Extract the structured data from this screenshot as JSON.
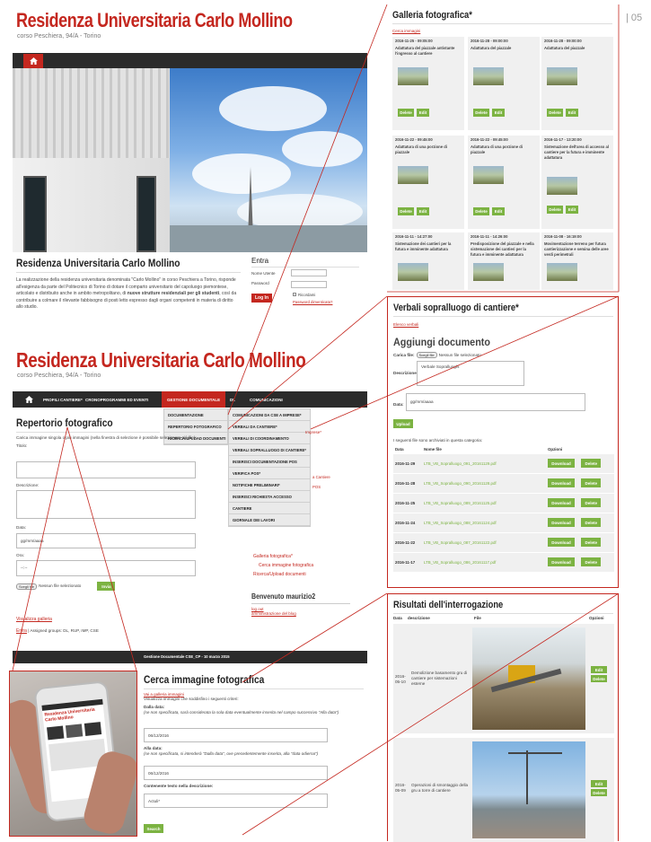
{
  "page_number": "| 05",
  "header1": {
    "title": "Residenza Universitaria Carlo Mollino",
    "subtitle": "corso Peschiera, 94/A - Torino"
  },
  "intro": {
    "title": "Residenza Universitaria Carlo Mollino",
    "text1": "La realizzazione della residenza universitaria denominata \"Carlo Mollino\" in corso Peschiera a Torino, risponde all'esigenza da parte del Politecnico di Torino di dotare il comparto universitario del capoluogo piemontese, articolato e distribuito anche in ambito metropolitano, di",
    "bold": "nuove strutture residenziali per gli studenti",
    "text2": ", così da contribuire a colmare il rilevante fabbisogno di posti letto espresso dagli organi competenti in materia di diritto allo studio."
  },
  "login": {
    "title": "Entra",
    "user_label": "Nome Utente",
    "pass_label": "Password",
    "button": "Log In",
    "remember": "Ricordami",
    "forgot": "Password dimenticata?"
  },
  "header2": {
    "title": "Residenza Universitaria Carlo Mollino",
    "subtitle": "corso Peschiera, 94/A - Torino"
  },
  "nav": {
    "items": [
      "PROFILI CANTIERE*",
      "CRONOPROGRAMMI ED EVENTI",
      "GESTIONE DOCUMENTALE",
      "DL",
      "COMUNICAZIONI"
    ]
  },
  "dropdown1": [
    "DOCUMENTAZIONE",
    "REPERTORIO FOTOGRAFICO",
    "RICERCA/UPLOAD DOCUMENTI"
  ],
  "dropdown2": [
    "COMUNICAZIONI DA CSE A IMPRESE*",
    "VERBALI DA CANTIERE*",
    "VERBALI DI COORDINAMENTO",
    "VERBALI SOPRALLUOGO DI CANTIERE*",
    "INSERISCI DOCUMENTAZIONE POS",
    "VERIFICA POS*",
    "NOTIFICHE PRELIMINARI*",
    "INSERISCI RICHIESTA ACCESSO",
    "CANTIERE",
    "GIORNALE DEI LAVORI"
  ],
  "repertorio": {
    "title": "Repertorio fotografico",
    "desc": "Carica immagine singola o più immagini (nella finestra di selezione è possibile selezionare più file):",
    "titolo": "Titolo:",
    "descrizione": "Descrizione:",
    "data": "Data:",
    "data_ph": "gg/mm/aaaa",
    "ora": "Ora:",
    "ora_ph": "--:--",
    "file_btn": "Scegli file",
    "no_file": "Nessun file selezionato",
    "invia": "Invia",
    "visualizza": "Visualizza galleria",
    "footer_link": "Entra",
    "footer_text": "| Assigned groups: DL, RUP, IMP, CSE"
  },
  "sidebar": {
    "links": [
      "Imprese*",
      "…",
      "a Cantiere",
      "POS"
    ],
    "sub_links": [
      "Galleria fotografica*",
      "Cerca immagine fotografica",
      "Ricerca/Upload documenti"
    ],
    "welcome": "Benvenuto maurizio2",
    "logout": "log out",
    "admin": "amministrazione del blog"
  },
  "footerbar": "Gestione Documentale CSE_CP - 10 marzo 2015",
  "galleria": {
    "title": "Galleria fotografica*",
    "link": "Cerca immagini",
    "items": [
      {
        "date": "2016-11-25 - 09:05:00",
        "desc": "Adattatura del piazzale antistante l'ingresso al cantiere"
      },
      {
        "date": "2016-11-28 - 09:00:00",
        "desc": "Adattatura del piazzale"
      },
      {
        "date": "2016-11-28 - 09:00:00",
        "desc": "Adattatura del piazzale"
      },
      {
        "date": "2016-11-22 - 09:45:00",
        "desc": "Adattatura di una porzione di piazzale"
      },
      {
        "date": "2016-11-22 - 09:45:00",
        "desc": "Adattatura di una porzione di piazzale"
      },
      {
        "date": "2016-11-17 - 13:20:00",
        "desc": "Sistemazione dell'area di accesso al cantiere per la futura e imminente adattatura"
      },
      {
        "date": "2016-11-11 - 14:27:00",
        "desc": "Sistemazione dei cantieri per la futura e imminente adattatura"
      },
      {
        "date": "2016-11-11 - 14:26:00",
        "desc": "Predisposizione del piazzale e nella sistemazione dei cantieri per la futura e imminente adattatura"
      },
      {
        "date": "2016-11-08 - 16:19:00",
        "desc": "Movimentazione terreno per futura cantierizzazione e semina delle aree verdi perimetrali"
      }
    ],
    "delete": "Delete",
    "edit": "Edit"
  },
  "verbali": {
    "title": "Verbali sopralluogo di cantiere*",
    "link": "Elenco verbali",
    "subtitle": "Aggiungi documento",
    "carica": "Carica file:",
    "file_btn": "Scegli file",
    "no_file": "Nessun file selezionato",
    "descr_label": "Descrizione:",
    "descr_val": "Verbale Sopralluoghi",
    "data_label": "Data:",
    "data_val": "gg/mm/aaaa",
    "upload": "Upload",
    "info": "I seguenti file sono archiviati in questa categoria:",
    "cols": [
      "Data",
      "Nome file",
      "Opzioni"
    ],
    "rows": [
      {
        "date": "2016-11-29",
        "file": "LTB_VB_Sopralluogo_091_20161129.pdf"
      },
      {
        "date": "2016-11-28",
        "file": "LTB_VB_Sopralluogo_090_20161128.pdf"
      },
      {
        "date": "2016-11-25",
        "file": "LTB_VB_Sopralluogo_089_20161125.pdf"
      },
      {
        "date": "2016-11-24",
        "file": "LTB_VB_Sopralluogo_088_20161124.pdf"
      },
      {
        "date": "2016-11-22",
        "file": "LTB_VB_Sopralluogo_087_20161122.pdf"
      },
      {
        "date": "2016-11-17",
        "file": "LTB_VB_Sopralluogo_086_20161117.pdf"
      }
    ],
    "download": "Download",
    "delete": "Delete"
  },
  "risultati": {
    "title": "Risultati dell'interrogazione",
    "cols": [
      "Data",
      "descrizione",
      "File",
      "Opzioni"
    ],
    "rows": [
      {
        "date": "2016-05-10",
        "desc": "Demolizione basamento gru di cantiere per sistemazioni esterne"
      },
      {
        "date": "2016-05-09",
        "desc": "Operazioni di smontaggio della gru a torre di cantiere"
      }
    ],
    "edit": "Edit",
    "delete": "Delete"
  },
  "cerca": {
    "title": "Cerca immagine fotografica",
    "link": "Vai a galleria immagini",
    "desc": "Visualizza immagini che soddisfino i seguenti criteri:",
    "dalla": "Dalla data:",
    "dalla_note": "(se non specificata, sarà considerata la sola data eventualmente inserita nel campo successivo \"Alla data\")",
    "dalla_val": "06/12/2016",
    "alla": "Alla data:",
    "alla_note": "(se non specificata, si intenderà \"Dalla data\", ove precedentemente inserita, alla \"data odierna\")",
    "alla_val": "06/12/2016",
    "contenuto": "Contenente testo nella descrizione:",
    "contenuto_val": "Actuli*",
    "search": "Search"
  },
  "phone_screen": {
    "title": "Residenza Universitaria Carlo Mollino"
  },
  "colors": {
    "accent": "#c4271f",
    "green": "#7cb342",
    "dark": "#2b2b2b"
  }
}
